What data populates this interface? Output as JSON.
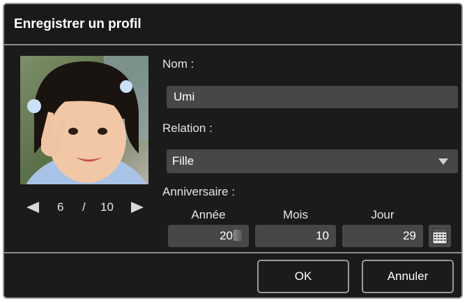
{
  "dialog": {
    "title": "Enregistrer un profil"
  },
  "photo": {
    "icon": "portrait-photo"
  },
  "pager": {
    "current": "6",
    "separator": "/",
    "total": "10"
  },
  "form": {
    "name_label": "Nom :",
    "name_value": "Umi",
    "relation_label": "Relation :",
    "relation_value": "Fille",
    "birthday_label": "Anniversaire :",
    "year_label": "Année",
    "month_label": "Mois",
    "day_label": "Jour",
    "year_value": "20",
    "month_value": "10",
    "day_value": "29"
  },
  "buttons": {
    "ok": "OK",
    "cancel": "Annuler"
  },
  "colors": {
    "background": "#1b1b1b",
    "field": "#474747",
    "border": "#9a9a9a"
  }
}
